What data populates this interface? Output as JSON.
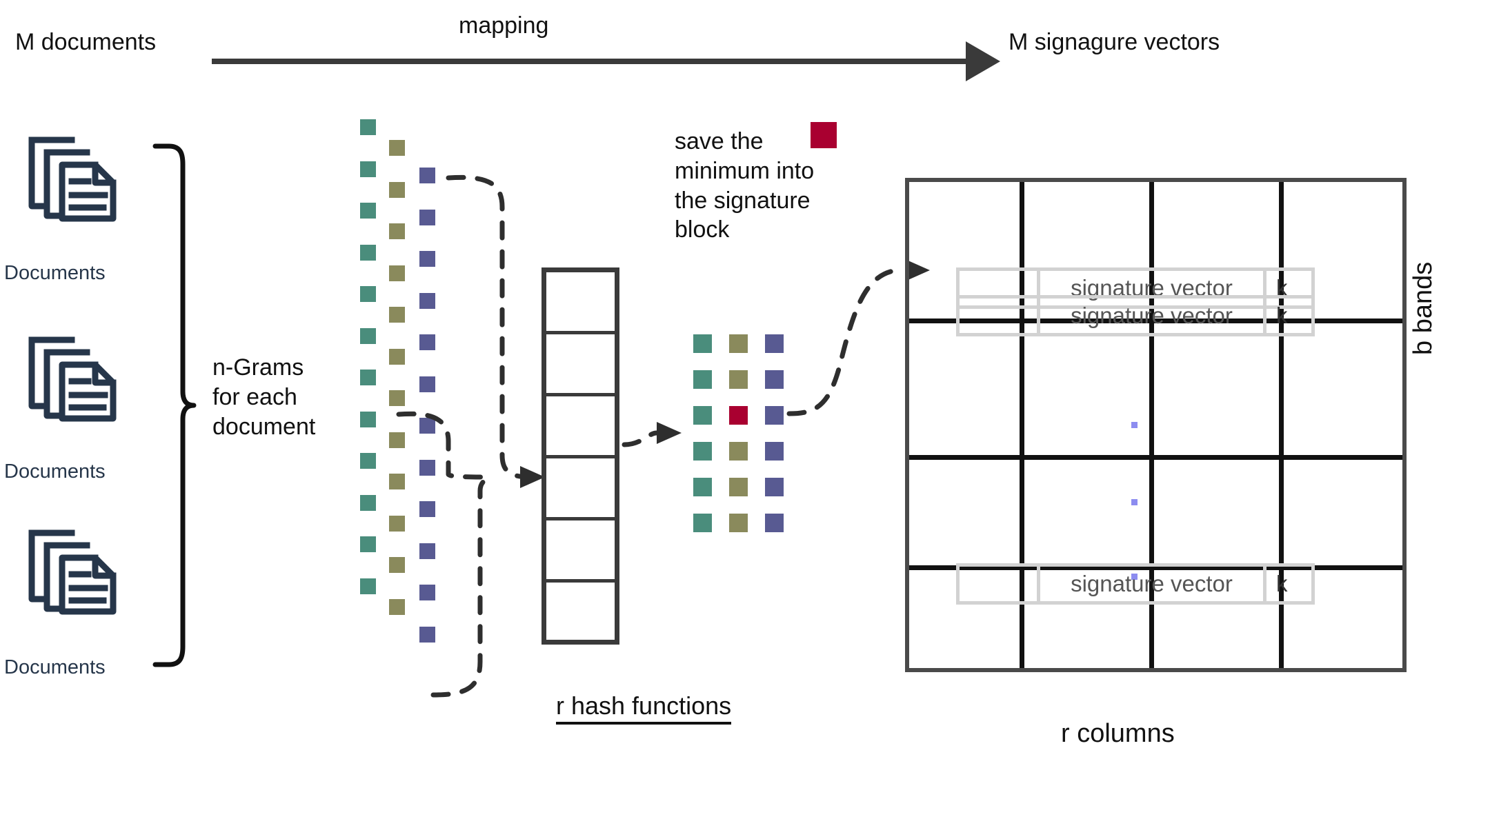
{
  "header": {
    "source_label": "M documents",
    "arrow_label": "mapping",
    "target_label": "M signagure vectors"
  },
  "documents": {
    "icon_name": "documents-stack-icon",
    "items": [
      {
        "label": "Documents"
      },
      {
        "label": "Documents"
      },
      {
        "label": "Documents"
      }
    ],
    "brace_label": "n-Grams\nfor each\ndocument",
    "brace_line1": "n-Grams",
    "brace_line2": "for each",
    "brace_line3": "document"
  },
  "ngrams": {
    "colors": {
      "teal": "#4a8d7c",
      "olive": "#8a8a5c",
      "purple": "#585a92",
      "red": "#a90030"
    },
    "column_count": 3,
    "rows_per_column": 12
  },
  "hash_table": {
    "caption": "r hash functions",
    "cell_count": 6
  },
  "minhash_note": {
    "line1": "save the",
    "line2": "minimum into",
    "line3": "the signature",
    "line4": "block",
    "swatch_color": "#a90030",
    "swatch_name": "minimum-red-swatch"
  },
  "signature_block": {
    "grid_columns": 4,
    "grid_rows": 4,
    "rows": [
      {
        "vector_label": "signature vector",
        "k_label": "k"
      },
      {
        "vector_label": "signature vector",
        "k_label": "k"
      },
      {
        "vector_label": "signature vector",
        "k_label": "k"
      }
    ],
    "ellipsis_dot_color": "#8c8cf0",
    "ellipsis_dot_count": 3,
    "bottom_label": "r columns",
    "side_label": "b bands"
  },
  "colors": {
    "document_icon": "#26364a",
    "arrow": "#3a3a3a",
    "grid_line": "#111111",
    "outer_border": "#4a4a4a",
    "sig_box_border": "#d2d2d2",
    "sig_box_text": "#555555"
  }
}
